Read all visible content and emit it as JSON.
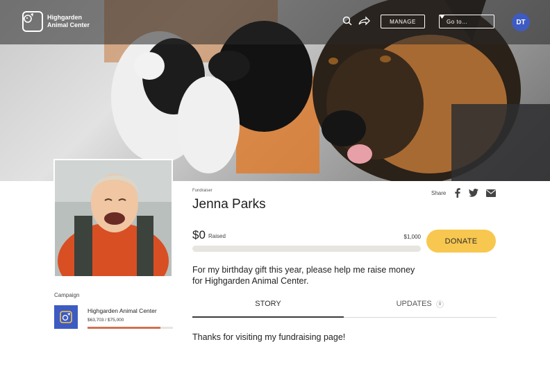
{
  "header": {
    "org_name": "Highgarden Animal Center",
    "manage_label": "MANAGE",
    "goto_label": "Go to...",
    "avatar_initials": "DT",
    "icons": [
      "search-icon",
      "share-arrow-icon",
      "chevron-down-icon"
    ]
  },
  "fundraiser": {
    "role_label": "Fundraiser",
    "name": "Jenna Parks",
    "share_label": "Share",
    "share_icons": [
      "facebook-icon",
      "twitter-icon",
      "email-icon"
    ],
    "raised_amount": "$0",
    "raised_label": "Raised",
    "goal_amount": "$1,000",
    "progress_fraction": 0,
    "donate_label": "DONATE",
    "description": "For my birthday gift this year, please help me raise money for Highgarden Animal Center."
  },
  "campaign": {
    "label": "Campaign",
    "name": "Highgarden Animal Center",
    "amount_text": "$63,703 / $75,000",
    "progress_fraction": 0.85
  },
  "tabs": [
    {
      "label": "STORY",
      "active": true
    },
    {
      "label": "UPDATES",
      "count": "0",
      "active": false
    }
  ],
  "story": {
    "text": "Thanks for visiting my fundraising page!"
  },
  "colors": {
    "accent": "#f8c74f",
    "brand_blue": "#3e5bc2",
    "campaign_bar": "#d2714e"
  }
}
